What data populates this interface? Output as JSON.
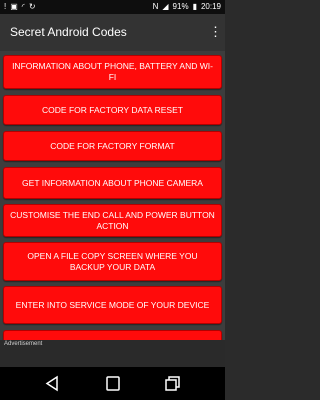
{
  "status_bar": {
    "time": "20:19",
    "battery": "91%"
  },
  "app_bar": {
    "title": "Secret Android Codes"
  },
  "buttons": [
    {
      "label": "INFORMATION ABOUT PHONE, BATTERY AND WI-FI"
    },
    {
      "label": "CODE FOR FACTORY DATA RESET"
    },
    {
      "label": "CODE FOR FACTORY FORMAT"
    },
    {
      "label": "GET INFORMATION ABOUT PHONE CAMERA"
    },
    {
      "label": "CUSTOMISE THE END CALL AND POWER BUTTON ACTION"
    },
    {
      "label": "OPEN A FILE COPY SCREEN WHERE YOU BACKUP YOUR DATA"
    },
    {
      "label": "ENTER INTO SERVICE MODE OF YOUR DEVICE"
    }
  ],
  "ad": {
    "label": "Advertisement"
  },
  "colors": {
    "button_red": "#ff0b0b",
    "app_bar": "#333333",
    "content_bg": "#3d3d3d"
  },
  "icons": {
    "status_left": [
      "alert-icon",
      "image-icon",
      "wifi-icon",
      "sync-icon"
    ],
    "status_right": [
      "nfc-icon",
      "signal-icon",
      "battery-icon"
    ],
    "nav": [
      "back-icon",
      "home-icon",
      "recents-icon"
    ],
    "menu": "overflow-menu-icon"
  }
}
